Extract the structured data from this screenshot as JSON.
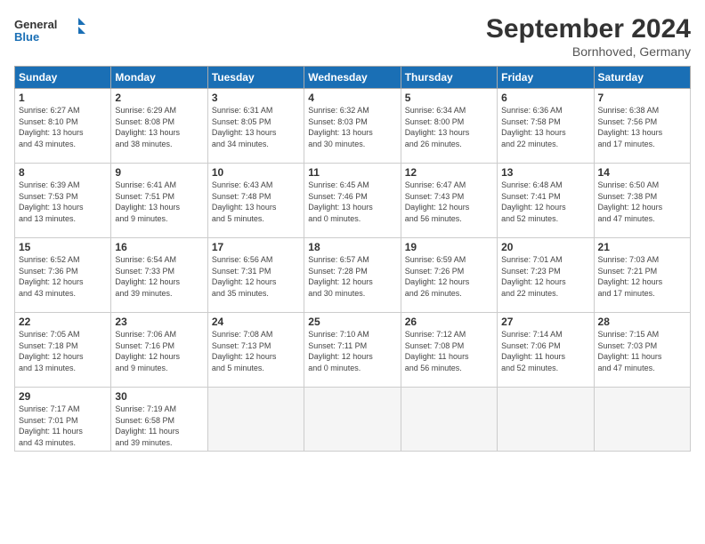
{
  "logo": {
    "line1": "General",
    "line2": "Blue"
  },
  "title": {
    "month": "September 2024",
    "location": "Bornhoved, Germany"
  },
  "weekdays": [
    "Sunday",
    "Monday",
    "Tuesday",
    "Wednesday",
    "Thursday",
    "Friday",
    "Saturday"
  ],
  "weeks": [
    [
      {
        "day": "1",
        "info": "Sunrise: 6:27 AM\nSunset: 8:10 PM\nDaylight: 13 hours\nand 43 minutes."
      },
      {
        "day": "2",
        "info": "Sunrise: 6:29 AM\nSunset: 8:08 PM\nDaylight: 13 hours\nand 38 minutes."
      },
      {
        "day": "3",
        "info": "Sunrise: 6:31 AM\nSunset: 8:05 PM\nDaylight: 13 hours\nand 34 minutes."
      },
      {
        "day": "4",
        "info": "Sunrise: 6:32 AM\nSunset: 8:03 PM\nDaylight: 13 hours\nand 30 minutes."
      },
      {
        "day": "5",
        "info": "Sunrise: 6:34 AM\nSunset: 8:00 PM\nDaylight: 13 hours\nand 26 minutes."
      },
      {
        "day": "6",
        "info": "Sunrise: 6:36 AM\nSunset: 7:58 PM\nDaylight: 13 hours\nand 22 minutes."
      },
      {
        "day": "7",
        "info": "Sunrise: 6:38 AM\nSunset: 7:56 PM\nDaylight: 13 hours\nand 17 minutes."
      }
    ],
    [
      {
        "day": "8",
        "info": "Sunrise: 6:39 AM\nSunset: 7:53 PM\nDaylight: 13 hours\nand 13 minutes."
      },
      {
        "day": "9",
        "info": "Sunrise: 6:41 AM\nSunset: 7:51 PM\nDaylight: 13 hours\nand 9 minutes."
      },
      {
        "day": "10",
        "info": "Sunrise: 6:43 AM\nSunset: 7:48 PM\nDaylight: 13 hours\nand 5 minutes."
      },
      {
        "day": "11",
        "info": "Sunrise: 6:45 AM\nSunset: 7:46 PM\nDaylight: 13 hours\nand 0 minutes."
      },
      {
        "day": "12",
        "info": "Sunrise: 6:47 AM\nSunset: 7:43 PM\nDaylight: 12 hours\nand 56 minutes."
      },
      {
        "day": "13",
        "info": "Sunrise: 6:48 AM\nSunset: 7:41 PM\nDaylight: 12 hours\nand 52 minutes."
      },
      {
        "day": "14",
        "info": "Sunrise: 6:50 AM\nSunset: 7:38 PM\nDaylight: 12 hours\nand 47 minutes."
      }
    ],
    [
      {
        "day": "15",
        "info": "Sunrise: 6:52 AM\nSunset: 7:36 PM\nDaylight: 12 hours\nand 43 minutes."
      },
      {
        "day": "16",
        "info": "Sunrise: 6:54 AM\nSunset: 7:33 PM\nDaylight: 12 hours\nand 39 minutes."
      },
      {
        "day": "17",
        "info": "Sunrise: 6:56 AM\nSunset: 7:31 PM\nDaylight: 12 hours\nand 35 minutes."
      },
      {
        "day": "18",
        "info": "Sunrise: 6:57 AM\nSunset: 7:28 PM\nDaylight: 12 hours\nand 30 minutes."
      },
      {
        "day": "19",
        "info": "Sunrise: 6:59 AM\nSunset: 7:26 PM\nDaylight: 12 hours\nand 26 minutes."
      },
      {
        "day": "20",
        "info": "Sunrise: 7:01 AM\nSunset: 7:23 PM\nDaylight: 12 hours\nand 22 minutes."
      },
      {
        "day": "21",
        "info": "Sunrise: 7:03 AM\nSunset: 7:21 PM\nDaylight: 12 hours\nand 17 minutes."
      }
    ],
    [
      {
        "day": "22",
        "info": "Sunrise: 7:05 AM\nSunset: 7:18 PM\nDaylight: 12 hours\nand 13 minutes."
      },
      {
        "day": "23",
        "info": "Sunrise: 7:06 AM\nSunset: 7:16 PM\nDaylight: 12 hours\nand 9 minutes."
      },
      {
        "day": "24",
        "info": "Sunrise: 7:08 AM\nSunset: 7:13 PM\nDaylight: 12 hours\nand 5 minutes."
      },
      {
        "day": "25",
        "info": "Sunrise: 7:10 AM\nSunset: 7:11 PM\nDaylight: 12 hours\nand 0 minutes."
      },
      {
        "day": "26",
        "info": "Sunrise: 7:12 AM\nSunset: 7:08 PM\nDaylight: 11 hours\nand 56 minutes."
      },
      {
        "day": "27",
        "info": "Sunrise: 7:14 AM\nSunset: 7:06 PM\nDaylight: 11 hours\nand 52 minutes."
      },
      {
        "day": "28",
        "info": "Sunrise: 7:15 AM\nSunset: 7:03 PM\nDaylight: 11 hours\nand 47 minutes."
      }
    ],
    [
      {
        "day": "29",
        "info": "Sunrise: 7:17 AM\nSunset: 7:01 PM\nDaylight: 11 hours\nand 43 minutes."
      },
      {
        "day": "30",
        "info": "Sunrise: 7:19 AM\nSunset: 6:58 PM\nDaylight: 11 hours\nand 39 minutes."
      },
      {
        "day": "",
        "info": ""
      },
      {
        "day": "",
        "info": ""
      },
      {
        "day": "",
        "info": ""
      },
      {
        "day": "",
        "info": ""
      },
      {
        "day": "",
        "info": ""
      }
    ]
  ]
}
